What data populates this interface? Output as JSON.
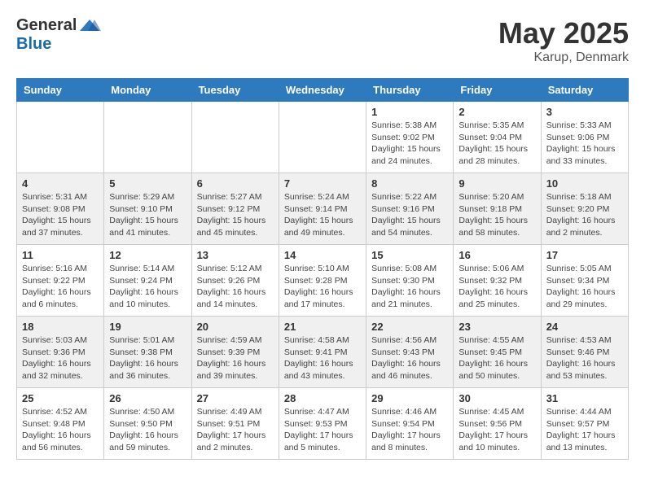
{
  "header": {
    "logo_general": "General",
    "logo_blue": "Blue",
    "month_title": "May 2025",
    "location": "Karup, Denmark"
  },
  "days_of_week": [
    "Sunday",
    "Monday",
    "Tuesday",
    "Wednesday",
    "Thursday",
    "Friday",
    "Saturday"
  ],
  "weeks": [
    [
      {
        "day": "",
        "info": ""
      },
      {
        "day": "",
        "info": ""
      },
      {
        "day": "",
        "info": ""
      },
      {
        "day": "",
        "info": ""
      },
      {
        "day": "1",
        "info": "Sunrise: 5:38 AM\nSunset: 9:02 PM\nDaylight: 15 hours\nand 24 minutes."
      },
      {
        "day": "2",
        "info": "Sunrise: 5:35 AM\nSunset: 9:04 PM\nDaylight: 15 hours\nand 28 minutes."
      },
      {
        "day": "3",
        "info": "Sunrise: 5:33 AM\nSunset: 9:06 PM\nDaylight: 15 hours\nand 33 minutes."
      }
    ],
    [
      {
        "day": "4",
        "info": "Sunrise: 5:31 AM\nSunset: 9:08 PM\nDaylight: 15 hours\nand 37 minutes."
      },
      {
        "day": "5",
        "info": "Sunrise: 5:29 AM\nSunset: 9:10 PM\nDaylight: 15 hours\nand 41 minutes."
      },
      {
        "day": "6",
        "info": "Sunrise: 5:27 AM\nSunset: 9:12 PM\nDaylight: 15 hours\nand 45 minutes."
      },
      {
        "day": "7",
        "info": "Sunrise: 5:24 AM\nSunset: 9:14 PM\nDaylight: 15 hours\nand 49 minutes."
      },
      {
        "day": "8",
        "info": "Sunrise: 5:22 AM\nSunset: 9:16 PM\nDaylight: 15 hours\nand 54 minutes."
      },
      {
        "day": "9",
        "info": "Sunrise: 5:20 AM\nSunset: 9:18 PM\nDaylight: 15 hours\nand 58 minutes."
      },
      {
        "day": "10",
        "info": "Sunrise: 5:18 AM\nSunset: 9:20 PM\nDaylight: 16 hours\nand 2 minutes."
      }
    ],
    [
      {
        "day": "11",
        "info": "Sunrise: 5:16 AM\nSunset: 9:22 PM\nDaylight: 16 hours\nand 6 minutes."
      },
      {
        "day": "12",
        "info": "Sunrise: 5:14 AM\nSunset: 9:24 PM\nDaylight: 16 hours\nand 10 minutes."
      },
      {
        "day": "13",
        "info": "Sunrise: 5:12 AM\nSunset: 9:26 PM\nDaylight: 16 hours\nand 14 minutes."
      },
      {
        "day": "14",
        "info": "Sunrise: 5:10 AM\nSunset: 9:28 PM\nDaylight: 16 hours\nand 17 minutes."
      },
      {
        "day": "15",
        "info": "Sunrise: 5:08 AM\nSunset: 9:30 PM\nDaylight: 16 hours\nand 21 minutes."
      },
      {
        "day": "16",
        "info": "Sunrise: 5:06 AM\nSunset: 9:32 PM\nDaylight: 16 hours\nand 25 minutes."
      },
      {
        "day": "17",
        "info": "Sunrise: 5:05 AM\nSunset: 9:34 PM\nDaylight: 16 hours\nand 29 minutes."
      }
    ],
    [
      {
        "day": "18",
        "info": "Sunrise: 5:03 AM\nSunset: 9:36 PM\nDaylight: 16 hours\nand 32 minutes."
      },
      {
        "day": "19",
        "info": "Sunrise: 5:01 AM\nSunset: 9:38 PM\nDaylight: 16 hours\nand 36 minutes."
      },
      {
        "day": "20",
        "info": "Sunrise: 4:59 AM\nSunset: 9:39 PM\nDaylight: 16 hours\nand 39 minutes."
      },
      {
        "day": "21",
        "info": "Sunrise: 4:58 AM\nSunset: 9:41 PM\nDaylight: 16 hours\nand 43 minutes."
      },
      {
        "day": "22",
        "info": "Sunrise: 4:56 AM\nSunset: 9:43 PM\nDaylight: 16 hours\nand 46 minutes."
      },
      {
        "day": "23",
        "info": "Sunrise: 4:55 AM\nSunset: 9:45 PM\nDaylight: 16 hours\nand 50 minutes."
      },
      {
        "day": "24",
        "info": "Sunrise: 4:53 AM\nSunset: 9:46 PM\nDaylight: 16 hours\nand 53 minutes."
      }
    ],
    [
      {
        "day": "25",
        "info": "Sunrise: 4:52 AM\nSunset: 9:48 PM\nDaylight: 16 hours\nand 56 minutes."
      },
      {
        "day": "26",
        "info": "Sunrise: 4:50 AM\nSunset: 9:50 PM\nDaylight: 16 hours\nand 59 minutes."
      },
      {
        "day": "27",
        "info": "Sunrise: 4:49 AM\nSunset: 9:51 PM\nDaylight: 17 hours\nand 2 minutes."
      },
      {
        "day": "28",
        "info": "Sunrise: 4:47 AM\nSunset: 9:53 PM\nDaylight: 17 hours\nand 5 minutes."
      },
      {
        "day": "29",
        "info": "Sunrise: 4:46 AM\nSunset: 9:54 PM\nDaylight: 17 hours\nand 8 minutes."
      },
      {
        "day": "30",
        "info": "Sunrise: 4:45 AM\nSunset: 9:56 PM\nDaylight: 17 hours\nand 10 minutes."
      },
      {
        "day": "31",
        "info": "Sunrise: 4:44 AM\nSunset: 9:57 PM\nDaylight: 17 hours\nand 13 minutes."
      }
    ]
  ]
}
